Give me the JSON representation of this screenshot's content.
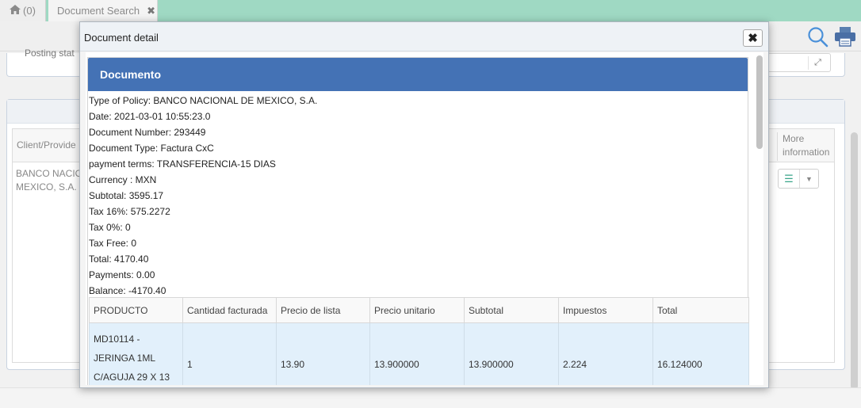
{
  "tabs": {
    "home_count": "(0)",
    "document_search": "Document Search"
  },
  "background": {
    "posting_label": "Posting stat",
    "col_client": "Client/Provide",
    "col_more_line1": "More",
    "col_more_line2": "information",
    "client_line1": "BANCO NACIO",
    "client_line2": "MEXICO, S.A."
  },
  "modal": {
    "title": "Document detail",
    "section_title": "Documento",
    "info": [
      "Type of Policy: BANCO NACIONAL DE MEXICO, S.A.",
      "Date: 2021-03-01 10:55:23.0",
      "Document Number: 293449",
      "Document Type: Factura CxC",
      "payment terms: TRANSFERENCIA-15 DIAS",
      "Currency : MXN",
      "Subtotal: 3595.17",
      "Tax 16%: 575.2272",
      "Tax 0%: 0",
      "Tax Free: 0",
      "Total: 4170.40",
      "Payments: 0.00",
      "Balance: -4170.40"
    ],
    "table": {
      "headers": [
        "PRODUCTO",
        "Cantidad facturada",
        "Precio de lista",
        "Precio unitario",
        "Subtotal",
        "Impuestos",
        "Total"
      ],
      "rows": [
        {
          "producto_lines": [
            "MD10114 -",
            "JERINGA 1ML",
            "C/AGUJA 29 X 13"
          ],
          "cantidad": "1",
          "precio_lista": "13.90",
          "precio_unitario": "13.900000",
          "subtotal": "13.900000",
          "impuestos": "2.224",
          "total": "16.124000"
        }
      ]
    }
  },
  "icons": {
    "home": "home-icon",
    "close_tab": "close-icon",
    "search": "search-icon",
    "print": "print-icon",
    "modal_close": "close-icon",
    "expand": "expand-icon",
    "list": "list-icon",
    "dropdown": "chevron-down-icon"
  },
  "colors": {
    "tabbar": "#9fd9c3",
    "doc_heading": "#4472b5",
    "row_highlight": "#e2f0fb",
    "icon_blue": "#4a90d9"
  }
}
